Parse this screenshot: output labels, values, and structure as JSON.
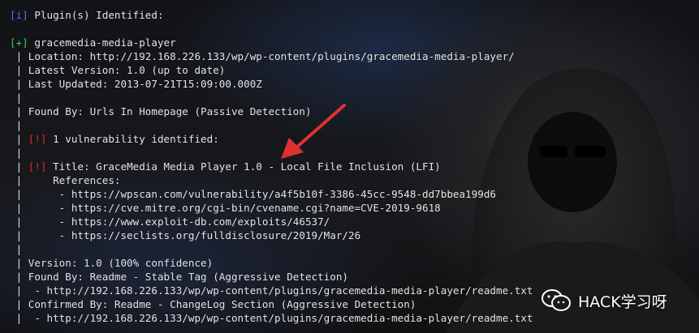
{
  "terminal": {
    "lines": [
      {
        "prefix": "[i]",
        "prefix_color": "#5a6cff",
        "text": " Plugin(s) Identified:"
      },
      {
        "prefix": "",
        "text": ""
      },
      {
        "prefix": "[+]",
        "prefix_color": "#35d35a",
        "text": " gracemedia-media-player"
      },
      {
        "prefix": "",
        "text": " | Location: http://192.168.226.133/wp/wp-content/plugins/gracemedia-media-player/"
      },
      {
        "prefix": "",
        "text": " | Latest Version: 1.0 (up to date)"
      },
      {
        "prefix": "",
        "text": " | Last Updated: 2013-07-21T15:09:00.000Z"
      },
      {
        "prefix": "",
        "text": " |"
      },
      {
        "prefix": "",
        "text": " | Found By: Urls In Homepage (Passive Detection)"
      },
      {
        "prefix": "",
        "text": " |"
      },
      {
        "prefix": " | ",
        "text": "",
        "prefix_color": "#e6e6e6",
        "sub_prefix": "[!]",
        "sub_prefix_color": "#e03131",
        "rest": " 1 vulnerability identified:"
      },
      {
        "prefix": "",
        "text": " |"
      },
      {
        "prefix": " | ",
        "text": "",
        "prefix_color": "#e6e6e6",
        "sub_prefix": "[!]",
        "sub_prefix_color": "#e03131",
        "rest": " Title: GraceMedia Media Player 1.0 - Local File Inclusion (LFI)"
      },
      {
        "prefix": "",
        "text": " |     References:"
      },
      {
        "prefix": "",
        "text": " |      - https://wpscan.com/vulnerability/a4f5b10f-3386-45cc-9548-dd7bbea199d6"
      },
      {
        "prefix": "",
        "text": " |      - https://cve.mitre.org/cgi-bin/cvename.cgi?name=CVE-2019-9618"
      },
      {
        "prefix": "",
        "text": " |      - https://www.exploit-db.com/exploits/46537/"
      },
      {
        "prefix": "",
        "text": " |      - https://seclists.org/fulldisclosure/2019/Mar/26"
      },
      {
        "prefix": "",
        "text": " |"
      },
      {
        "prefix": "",
        "text": " | Version: 1.0 (100% confidence)"
      },
      {
        "prefix": "",
        "text": " | Found By: Readme - Stable Tag (Aggressive Detection)"
      },
      {
        "prefix": "",
        "text": " |  - http://192.168.226.133/wp/wp-content/plugins/gracemedia-media-player/readme.txt"
      },
      {
        "prefix": "",
        "text": " | Confirmed By: Readme - ChangeLog Section (Aggressive Detection)"
      },
      {
        "prefix": "",
        "text": " |  - http://192.168.226.133/wp/wp-content/plugins/gracemedia-media-player/readme.txt"
      }
    ]
  },
  "watermark": {
    "text": "HACK学习呀",
    "icon": "wechat-icon"
  },
  "colors": {
    "arrow": "#e03131",
    "info_tag": "#5a6cff",
    "success_tag": "#35d35a",
    "alert_tag": "#e03131"
  }
}
